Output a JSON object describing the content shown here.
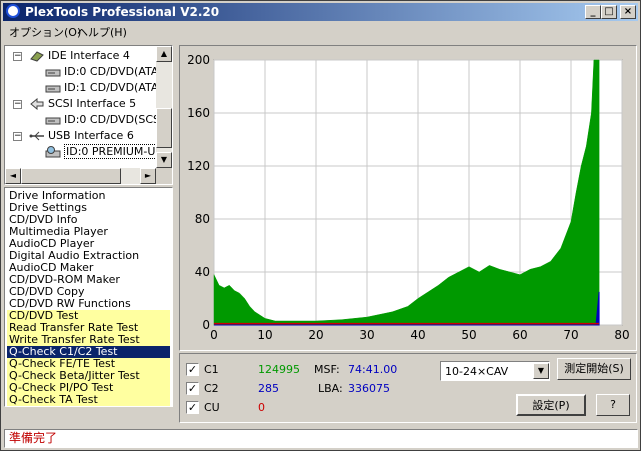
{
  "window": {
    "title": "PlexTools Professional V2.20"
  },
  "title_buttons": {
    "minimize": "_",
    "maximize": "□",
    "close": "×"
  },
  "menu": [
    {
      "label": "オプション(O)"
    },
    {
      "label": "ヘルプ(H)"
    }
  ],
  "tree": {
    "rows": [
      {
        "label": "IDE Interface 4",
        "icon": "ide-icon",
        "expander": "−"
      },
      {
        "label": "ID:0  CD/DVD(ATA",
        "icon": "drive-icon"
      },
      {
        "label": "ID:1  CD/DVD(ATA",
        "icon": "drive-icon"
      },
      {
        "label": "SCSI Interface 5",
        "icon": "scsi-icon",
        "expander": "−"
      },
      {
        "label": "ID:0  CD/DVD(SCS",
        "icon": "drive-icon"
      },
      {
        "label": "USB Interface 6",
        "icon": "usb-icon",
        "expander": "−"
      },
      {
        "label": "ID:0  PREMIUM-U",
        "icon": "disc-drive-icon",
        "selected": true
      }
    ]
  },
  "functions": {
    "items": [
      {
        "label": "Drive Information"
      },
      {
        "label": "Drive Settings"
      },
      {
        "label": "CD/DVD Info"
      },
      {
        "label": "Multimedia Player"
      },
      {
        "label": "AudioCD Player"
      },
      {
        "label": "Digital Audio Extraction"
      },
      {
        "label": "AudioCD Maker"
      },
      {
        "label": "CD/DVD-ROM Maker"
      },
      {
        "label": "CD/DVD Copy"
      },
      {
        "label": "CD/DVD RW Functions"
      },
      {
        "label": "CD/DVD Test",
        "test": true
      },
      {
        "label": "Read Transfer Rate Test",
        "test": true
      },
      {
        "label": "Write Transfer Rate Test",
        "test": true
      },
      {
        "label": "Q-Check C1/C2 Test",
        "selected": true
      },
      {
        "label": "Q-Check FE/TE Test",
        "test": true
      },
      {
        "label": "Q-Check Beta/Jitter Test",
        "test": true
      },
      {
        "label": "Q-Check PI/PO Test",
        "test": true
      },
      {
        "label": "Q-Check TA Test",
        "test": true
      }
    ]
  },
  "chart_data": {
    "type": "area",
    "x_ticks": [
      "0",
      "10",
      "20",
      "30",
      "40",
      "50",
      "60",
      "70",
      "80"
    ],
    "y_ticks": [
      "0",
      "40",
      "80",
      "120",
      "160",
      "200"
    ],
    "xlim": [
      0,
      80
    ],
    "ylim": [
      0,
      200
    ],
    "grid": true,
    "colors": {
      "background": "#ffffff",
      "grid": "#c8c8c8",
      "c1": "#009900",
      "c2": "#0000c0",
      "cu": "#cc0000"
    },
    "series": [
      {
        "key": "C1",
        "x": [
          0,
          1,
          2,
          3,
          4,
          5,
          6,
          7,
          8,
          10,
          12,
          15,
          20,
          25,
          30,
          35,
          38,
          40,
          42,
          44,
          46,
          48,
          50,
          52,
          54,
          56,
          58,
          60,
          62,
          64,
          66,
          68,
          70,
          71,
          72,
          73,
          74,
          74.5,
          75,
          75.5
        ],
        "values": [
          38,
          30,
          28,
          30,
          26,
          24,
          20,
          14,
          10,
          5,
          3,
          3,
          3,
          4,
          6,
          10,
          14,
          20,
          25,
          30,
          36,
          40,
          44,
          40,
          45,
          42,
          40,
          38,
          42,
          44,
          48,
          58,
          78,
          100,
          120,
          135,
          160,
          200,
          200,
          200
        ]
      },
      {
        "key": "C2",
        "x": [
          0,
          74.9,
          75.2,
          75.5
        ],
        "values": [
          0,
          0,
          12,
          25
        ]
      },
      {
        "key": "CU",
        "x": [
          0,
          75.5
        ],
        "values": [
          1,
          1
        ]
      }
    ]
  },
  "stats": {
    "c1": {
      "label": "C1",
      "value": "124995",
      "checked": "✓"
    },
    "c2": {
      "label": "C2",
      "value": "285",
      "checked": "✓"
    },
    "cu": {
      "label": "CU",
      "value": "0",
      "checked": "✓"
    },
    "msf_label": "MSF:",
    "msf_value": "74:41.00",
    "lba_label": "LBA:",
    "lba_value": "336075"
  },
  "controls": {
    "speed_value": "10-24×CAV",
    "start_button": "測定開始(S)",
    "settings_button": "設定(P)",
    "help_button": "?"
  },
  "status": {
    "text": "準備完了"
  }
}
